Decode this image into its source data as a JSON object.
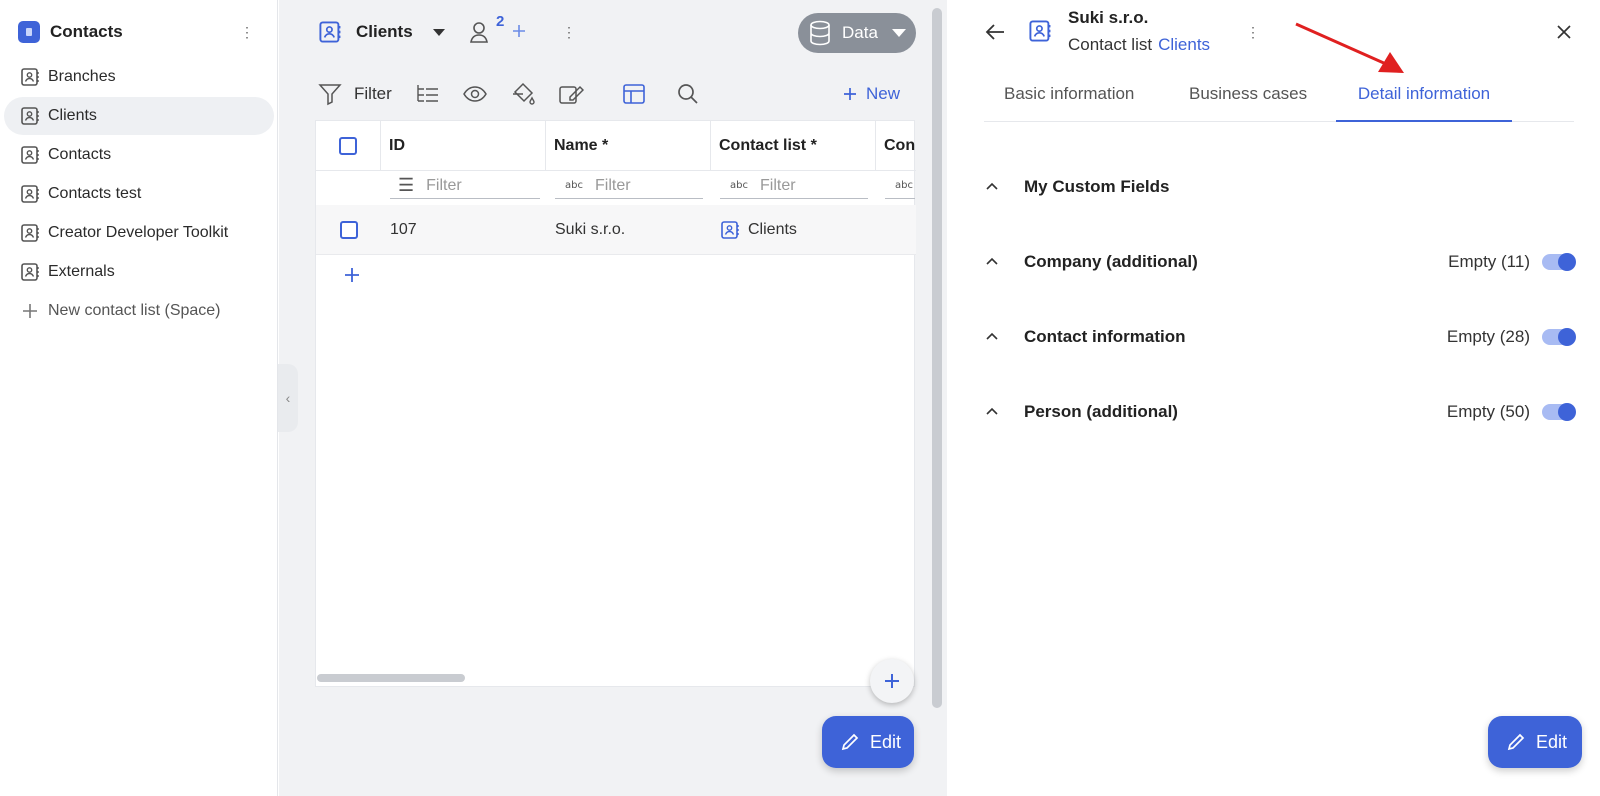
{
  "sidebar": {
    "app_title": "Contacts",
    "items": [
      {
        "label": "Branches"
      },
      {
        "label": "Clients"
      },
      {
        "label": "Contacts"
      },
      {
        "label": "Contacts test"
      },
      {
        "label": "Creator Developer Toolkit"
      },
      {
        "label": "Externals"
      }
    ],
    "new_label": "New contact list (Space)",
    "active_item": "Clients"
  },
  "middle": {
    "title": "Clients",
    "users_count": "2",
    "data_button": "Data",
    "filter_label": "Filter",
    "new_label": "New",
    "columns": [
      "ID",
      "Name *",
      "Contact list *",
      "Con"
    ],
    "filter_placeholder": "Filter",
    "rows": [
      {
        "id": "107",
        "name": "Suki s.r.o.",
        "contact_list": "Clients"
      }
    ],
    "edit_label": "Edit"
  },
  "right": {
    "title": "Suki s.r.o.",
    "subtitle_prefix": "Contact list",
    "subtitle_link": "Clients",
    "tabs": [
      "Basic information",
      "Business cases",
      "Detail information"
    ],
    "active_tab": "Detail information",
    "sections": [
      {
        "label": "My Custom Fields",
        "empty": ""
      },
      {
        "label": "Company (additional)",
        "empty": "Empty (11)"
      },
      {
        "label": "Contact information",
        "empty": "Empty (28)"
      },
      {
        "label": "Person (additional)",
        "empty": "Empty (50)"
      }
    ],
    "edit_label": "Edit"
  },
  "colors": {
    "accent": "#3e63d8",
    "annotation_arrow": "#e02020",
    "data_button": "#8a9099"
  }
}
